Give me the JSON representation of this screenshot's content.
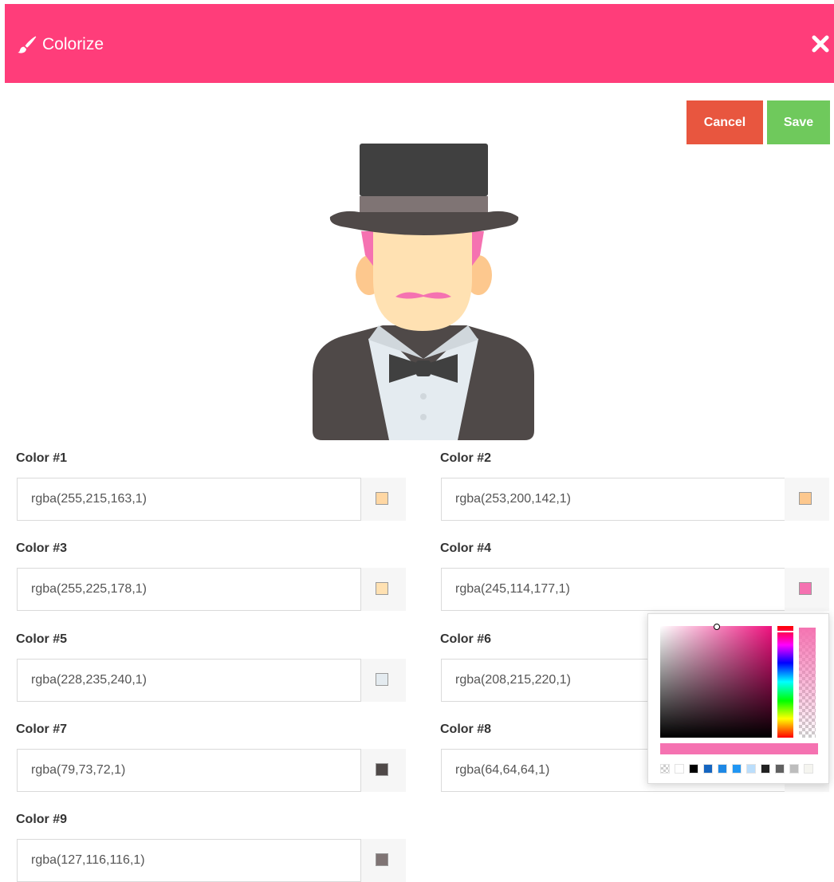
{
  "header": {
    "title": "Colorize",
    "brush_icon": "paintbrush-icon",
    "close_icon": "close-icon"
  },
  "actions": {
    "cancel_label": "Cancel",
    "save_label": "Save"
  },
  "fields": [
    {
      "label": "Color #1",
      "value": "rgba(255,215,163,1)",
      "swatch": "#ffd7a3"
    },
    {
      "label": "Color #2",
      "value": "rgba(253,200,142,1)",
      "swatch": "#fdc88e"
    },
    {
      "label": "Color #3",
      "value": "rgba(255,225,178,1)",
      "swatch": "#ffe1b2"
    },
    {
      "label": "Color #4",
      "value": "rgba(245,114,177,1)",
      "swatch": "#f572b1"
    },
    {
      "label": "Color #5",
      "value": "rgba(228,235,240,1)",
      "swatch": "#e4ebf0"
    },
    {
      "label": "Color #6",
      "value": "rgba(208,215,220,1)",
      "swatch": "#d0d7dc"
    },
    {
      "label": "Color #7",
      "value": "rgba(79,73,72,1)",
      "swatch": "#4f4948"
    },
    {
      "label": "Color #8",
      "value": "rgba(64,64,64,1)",
      "swatch": "#404040"
    },
    {
      "label": "Color #9",
      "value": "rgba(127,116,116,1)",
      "swatch": "#7f7474"
    }
  ],
  "picker": {
    "current_color": "#f572b1",
    "presets": [
      "transparent",
      "#ffffff",
      "#000000",
      "#1565c0",
      "#1e88e5",
      "#2196f3",
      "#bbdefb",
      "#212121",
      "#616161",
      "#bdbdbd",
      "#f5f5f0"
    ]
  },
  "colors": {
    "header": "#ff3d7a",
    "cancel": "#e8563f",
    "save": "#6fc95c"
  }
}
